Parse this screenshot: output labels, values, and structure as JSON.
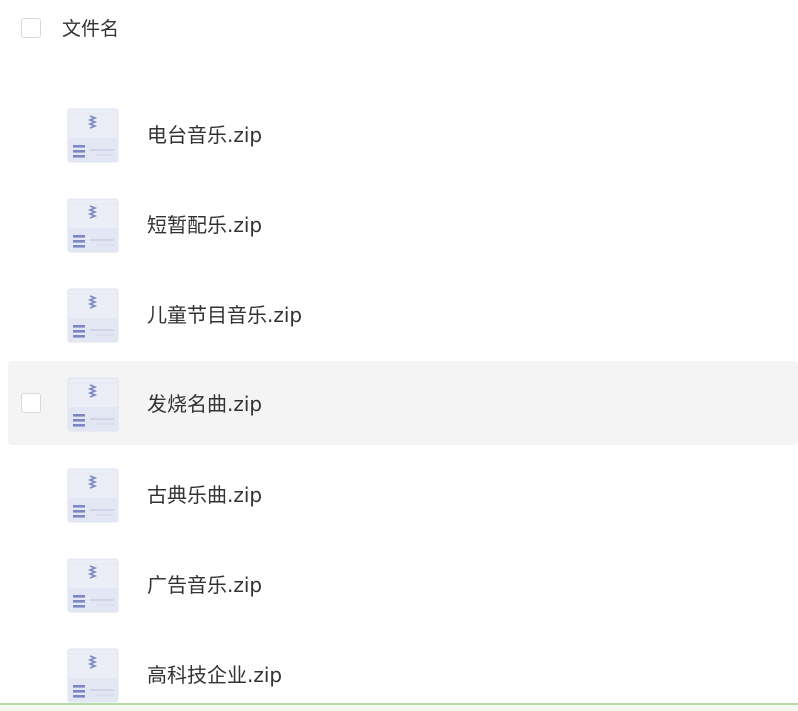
{
  "header": {
    "column_title": "文件名"
  },
  "files": [
    {
      "name": "电台音乐.zip",
      "icon": "zip-archive-icon"
    },
    {
      "name": "短暂配乐.zip",
      "icon": "zip-archive-icon"
    },
    {
      "name": "儿童节目音乐.zip",
      "icon": "zip-archive-icon"
    },
    {
      "name": "发烧名曲.zip",
      "icon": "zip-archive-icon",
      "hovered": true
    },
    {
      "name": "古典乐曲.zip",
      "icon": "zip-archive-icon"
    },
    {
      "name": "广告音乐.zip",
      "icon": "zip-archive-icon"
    },
    {
      "name": "高科技企业.zip",
      "icon": "zip-archive-icon"
    }
  ],
  "colors": {
    "hover_row": "#f4f4f5",
    "icon_blue": "#7c87c4",
    "bottom_accent": "#b5dca8"
  }
}
